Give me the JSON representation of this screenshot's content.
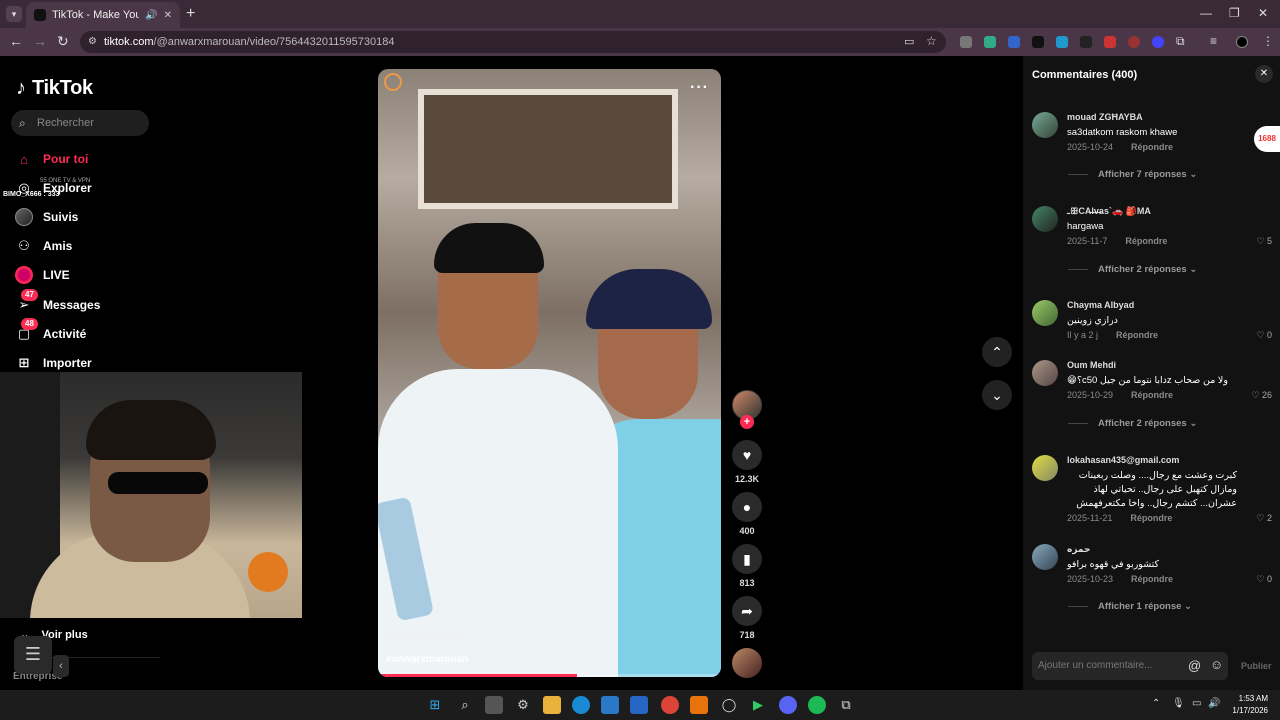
{
  "browser": {
    "tab_title": "TikTok - Make Your Day",
    "url_host": "tiktok.com",
    "url_path": "/@anwarxmarouan/video/7564432011595730184"
  },
  "sidebar": {
    "logo": "TikTok",
    "search_placeholder": "Rechercher",
    "items": [
      {
        "label": "Pour toi",
        "icon": "home-icon"
      },
      {
        "label": "Explorer",
        "icon": "compass-icon"
      },
      {
        "label": "Suivis",
        "icon": "avatar"
      },
      {
        "label": "Amis",
        "icon": "friends-icon"
      },
      {
        "label": "LIVE",
        "icon": "live-icon"
      },
      {
        "label": "Messages",
        "icon": "messages-icon",
        "badge": "47"
      },
      {
        "label": "Activité",
        "icon": "activity-icon",
        "badge": "48"
      },
      {
        "label": "Importer",
        "icon": "upload-icon"
      }
    ],
    "voir_plus": "Voir plus",
    "entreprise": "Entreprise"
  },
  "overlay": {
    "viewer_tag": "BIMO_X666 : 333",
    "small_text": "55 ONE TV & VPN"
  },
  "video": {
    "author": "anwarxmarouan",
    "hashtag": "#anwarxmarouan",
    "more": "···",
    "progress": 0.58
  },
  "actions": {
    "likes": "12.3K",
    "comments": "400",
    "saves": "813",
    "shares": "718"
  },
  "comments_panel": {
    "title": "Commentaires (400)",
    "input_placeholder": "Ajouter un commentaire...",
    "post_label": "Publier",
    "reply_label": "Répondre",
    "comments": [
      {
        "user": "mouad ZGĦAYBA",
        "text": "sa3datkom raskom khawe",
        "date": "2025-10-24",
        "likes": "",
        "replies": "Afficher 7 réponses"
      },
      {
        "user": "ـꕥCA̶l̶v̶as`🚗 🎒MA",
        "text": "hargawa",
        "date": "2025-11-7",
        "likes": "5",
        "replies": "Afficher 2 réponses"
      },
      {
        "user": "Chayma Albyad",
        "text": "درازي زوينين",
        "date": "Il y a 2 j",
        "likes": "0",
        "replies": ""
      },
      {
        "user": "Oum Mehdi",
        "text": "ولا من صحاب zدابا نتوما من جيل c50؟😁",
        "date": "2025-10-29",
        "likes": "26",
        "replies": "Afficher 2 réponses"
      },
      {
        "user": "lokahasan435@gmail.com",
        "text": "كبرت وعشت مع رجال.... وصلت ربعينات ومازال كتهبل على رجال.. تحياتي لهاذ عشران... كتشم رجال.. واخا مكتعرفهمش",
        "date": "2025-11-21",
        "likes": "2",
        "replies": ""
      },
      {
        "user": "حمزه",
        "text": "كتشوربو في قهوه برافو",
        "date": "2025-10-23",
        "likes": "0",
        "replies": "Afficher 1 réponse"
      }
    ]
  },
  "taskbar": {
    "time": "1:53 AM",
    "date": "1/17/2026"
  }
}
